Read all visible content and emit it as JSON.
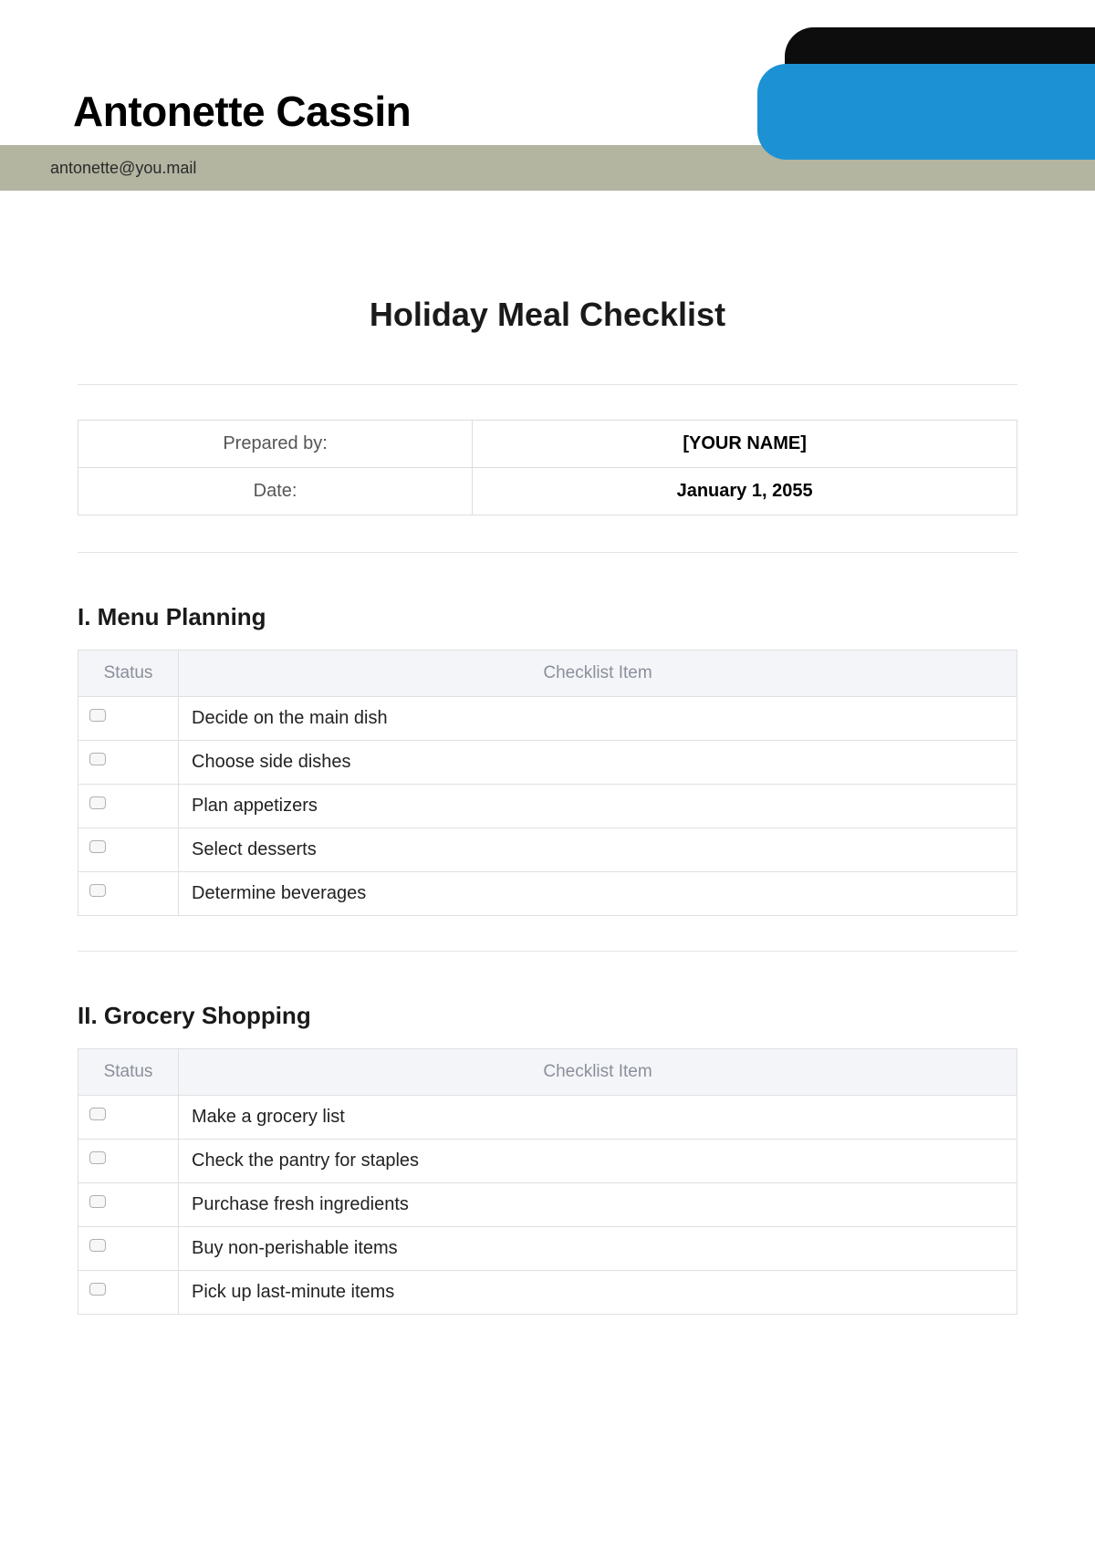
{
  "header": {
    "author_name": "Antonette Cassin",
    "email": "antonette@you.mail"
  },
  "document": {
    "title": "Holiday Meal Checklist"
  },
  "meta": {
    "prepared_by_label": "Prepared by:",
    "prepared_by_value": "[YOUR NAME]",
    "date_label": "Date:",
    "date_value": "January 1, 2055"
  },
  "columns": {
    "status": "Status",
    "item": "Checklist Item"
  },
  "sections": [
    {
      "heading": "I. Menu Planning",
      "items": [
        "Decide on the main dish",
        "Choose side dishes",
        "Plan appetizers",
        "Select desserts",
        "Determine beverages"
      ]
    },
    {
      "heading": "II. Grocery Shopping",
      "items": [
        "Make a grocery list",
        "Check the pantry for staples",
        "Purchase fresh ingredients",
        "Buy non-perishable items",
        "Pick up last-minute items"
      ]
    }
  ]
}
